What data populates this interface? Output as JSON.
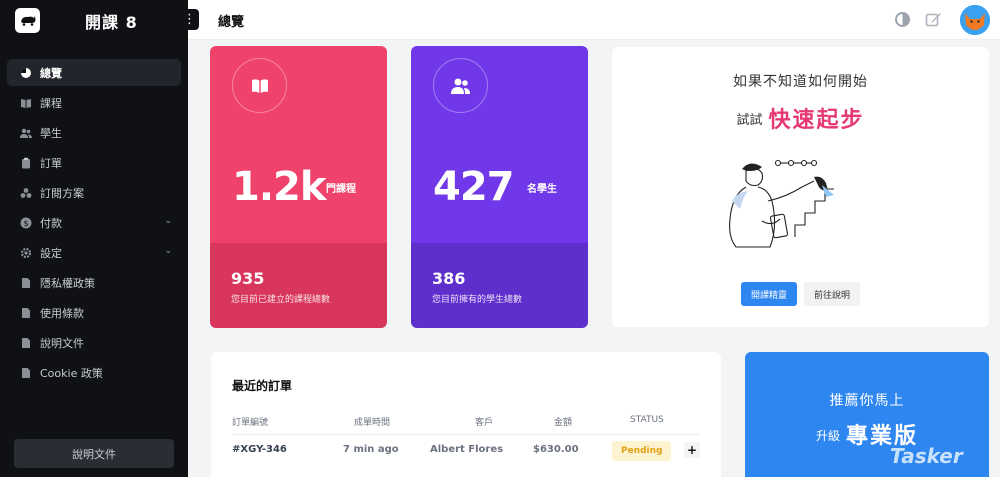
{
  "app": {
    "title": "開課 8"
  },
  "header": {
    "page_title": "總覽"
  },
  "sidebar": {
    "items": [
      {
        "label": "總覽",
        "active": true
      },
      {
        "label": "課程"
      },
      {
        "label": "學生"
      },
      {
        "label": "訂單"
      },
      {
        "label": "訂閱方案"
      },
      {
        "label": "付款",
        "expandable": true
      },
      {
        "label": "設定",
        "expandable": true
      },
      {
        "label": "隱私權政策"
      },
      {
        "label": "使用條款"
      },
      {
        "label": "說明文件"
      },
      {
        "label": "Cookie 政策"
      }
    ],
    "docs_button": "說明文件"
  },
  "stats": {
    "courses": {
      "number": "1.2k",
      "unit": "門課程",
      "small": "935",
      "desc": "您目前已建立的課程總數",
      "color": "#f0436c"
    },
    "students": {
      "number": "427",
      "unit": "名學生",
      "small": "386",
      "desc": "您目前擁有的學生總數",
      "color": "#7138ea"
    }
  },
  "quick_start": {
    "line1": "如果不知道如何開始",
    "line2_prefix": "試試",
    "line2_highlight": "快速起步",
    "primary_button": "開課精靈",
    "secondary_button": "前往說明"
  },
  "orders": {
    "title": "最近的訂單",
    "columns": [
      "訂單編號",
      "成單時間",
      "客戶",
      "金額",
      "STATUS"
    ],
    "rows": [
      {
        "id": "#XGY-346",
        "time": "7 min ago",
        "customer": "Albert Flores",
        "amount": "$630.00",
        "status": "Pending",
        "action": "+"
      }
    ]
  },
  "promo": {
    "line1": "推薦你馬上",
    "line2_prefix": "升級",
    "line2_highlight": "專業版"
  },
  "watermark": "Tasker"
}
